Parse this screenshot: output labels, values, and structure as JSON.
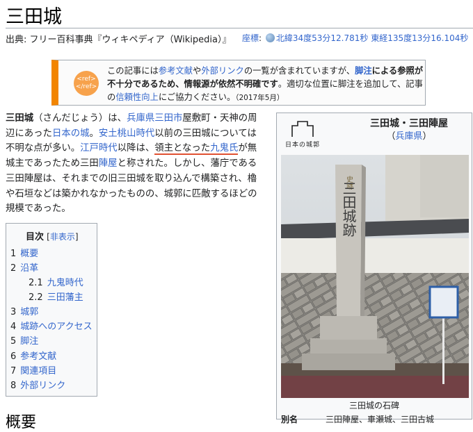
{
  "page": {
    "title": "三田城",
    "from_prefix": "出典: フリー百科事典『ウィキペディア（Wikipedia）』",
    "coords_label": "座標",
    "coords_sep": ": ",
    "coords_value": "北緯34度53分12.781秒 東経135度13分16.104秒"
  },
  "notice": {
    "icon_line1": "<ref>",
    "icon_line2": "</ref>",
    "t1": "この記事には",
    "l1": "参考文献",
    "t2": "や",
    "l2": "外部リンク",
    "t3": "の一覧が含まれていますが、",
    "l3": "脚注",
    "b1": "による参照が不十分であるため、情報源が依然不明確です",
    "t4": "。適切な位置に脚注を追加して、記事の",
    "l4": "信頼性向上",
    "t5": "にご協力ください。",
    "date": "（2017年5月）"
  },
  "lead": {
    "s1_bold": "三田城",
    "s2": "（さんだじょう）は、",
    "l_hyogo": "兵庫県",
    "l_sanda": "三田市",
    "s3": "屋敷町・天神の周辺にあった",
    "l_nihon": "日本の城",
    "s4": "。",
    "l_azuchi": "安土桃山時代",
    "s5": "以前の三田城については不明な点が多い。",
    "l_edo": "江戸時代",
    "s6": "以降は、",
    "s7_ul": "領主となった",
    "l_kuki": "九鬼氏",
    "s8": "が無城主であったため三田",
    "l_jinya": "陣屋",
    "s9": "と称された。しかし、藩庁である三田陣屋は、それまでの旧三田城を取り込んで構築され、櫓や石垣などは築かれなかったものの、城郭に匹敵するほどの規模であった。"
  },
  "toc": {
    "title": "目次",
    "hide_open": "[",
    "hide_label": "非表示",
    "hide_close": "]",
    "items": [
      {
        "num": "1",
        "label": "概要"
      },
      {
        "num": "2",
        "label": "沿革"
      },
      {
        "num": "2.1",
        "label": "九鬼時代"
      },
      {
        "num": "2.2",
        "label": "三田藩主"
      },
      {
        "num": "3",
        "label": "城郭"
      },
      {
        "num": "4",
        "label": "城跡へのアクセス"
      },
      {
        "num": "5",
        "label": "脚注"
      },
      {
        "num": "6",
        "label": "参考文献"
      },
      {
        "num": "7",
        "label": "関連項目"
      },
      {
        "num": "8",
        "label": "外部リンク"
      }
    ]
  },
  "section": {
    "heading": "概要"
  },
  "infobox": {
    "logo_text": "日本の城郭",
    "title": "三田城・三田陣屋",
    "sub_open": "（",
    "sub_link": "兵庫県",
    "sub_close": "）",
    "caption": "三田城の石碑",
    "monument_text": "史跡 三田城跡",
    "row_label": "別名",
    "row_value": "三田陣屋、車瀬城、三田古城"
  },
  "colors": {
    "link": "#3366cc",
    "notice_accent": "#f28500",
    "underline": "#e05030",
    "border": "#a2a9b1"
  }
}
